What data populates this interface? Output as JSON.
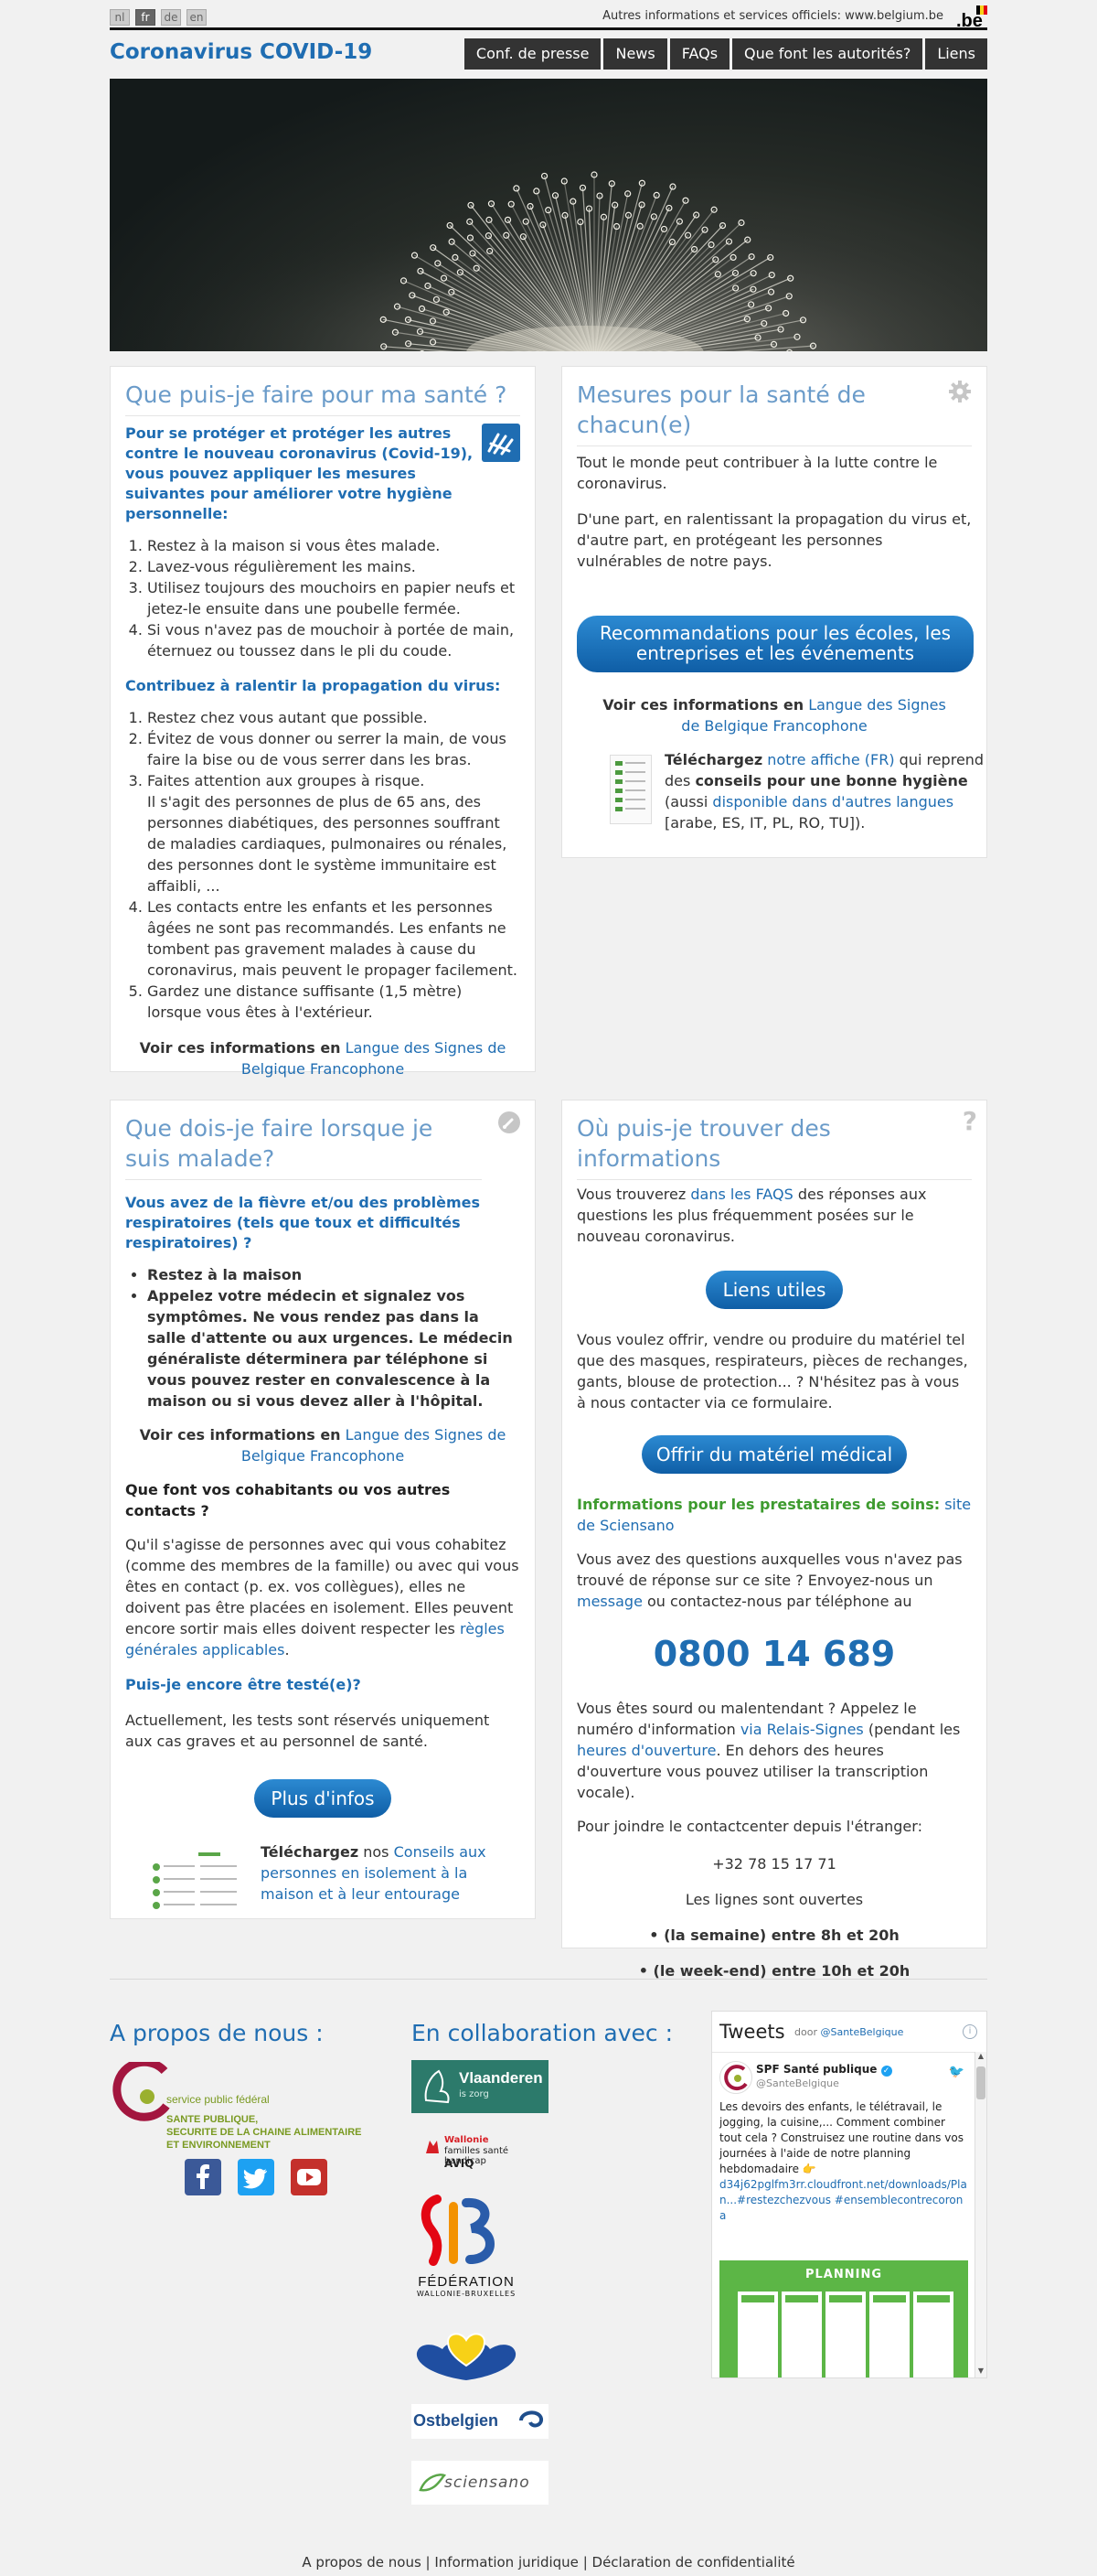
{
  "top": {
    "languages": [
      "nl",
      "fr",
      "de",
      "en"
    ],
    "gov_link": "Autres informations et services officiels: www.belgium.be",
    "be_logo": ".be"
  },
  "header": {
    "title": "Coronavirus COVID-19",
    "nav": [
      "Conf. de presse",
      "News",
      "FAQs",
      "Que font les autorités?",
      "Liens"
    ]
  },
  "panel_health": {
    "title": "Que puis-je faire pour ma santé ?",
    "intro": "Pour se protéger et protéger les autres contre le nouveau coronavirus (Covid-19), vous pouvez appliquer les mesures suivantes pour améliorer votre hygiène personnelle:",
    "hygiene": [
      "Restez à la maison si vous êtes malade.",
      "Lavez-vous régulièrement les mains.",
      "Utilisez toujours des mouchoirs en papier neufs et jetez-le ensuite dans une poubelle fermée.",
      "Si vous n'avez pas de mouchoir à portée de main, éternuez ou toussez dans le pli du coude."
    ],
    "slow_heading": "Contribuez à ralentir la propagation du virus:",
    "slow": [
      "Restez chez vous autant que possible.",
      "Évitez de vous donner ou serrer la main, de vous faire la bise ou de vous serrer dans les bras.",
      "Faites attention aux groupes à risque.",
      "Les contacts entre les enfants et les personnes âgées ne sont pas recommandés. Les enfants ne tombent pas gravement malades à cause du coronavirus, mais peuvent le propager facilement.",
      "Gardez une distance suffisante (1,5 mètre) lorsque vous êtes à l'extérieur."
    ],
    "risk_detail": "Il s'agit des personnes de plus de 65 ans, des personnes diabétiques, des personnes souffrant de maladies cardiaques, pulmonaires ou rénales, des personnes dont le système immunitaire est affaibli, ...",
    "sign_prefix": "Voir ces informations en",
    "sign_link": "Langue des Signes de Belgique Francophone"
  },
  "panel_measures": {
    "title": "Mesures pour la santé de chacun(e)",
    "p1": "Tout le monde peut contribuer à la lutte contre le coronavirus.",
    "p2": "D'une part, en ralentissant la propagation du virus et, d'autre part, en protégeant les personnes vulnérables de notre pays.",
    "btn": "Recommandations pour les écoles, les entreprises et les événements",
    "sign_prefix": "Voir ces informations en",
    "sign_link": "Langue des Signes de Belgique Francophone",
    "dl_bold": "Téléchargez",
    "dl_link": "notre affiche (FR)",
    "dl_mid": "qui reprend des",
    "dl_bold2": "conseils pour une bonne hygiène",
    "dl_aussi": "(aussi",
    "dl_link2": "disponible dans d'autres langues",
    "dl_end": "[arabe, ES, IT, PL, RO, TU])."
  },
  "panel_sick": {
    "title": "Que dois-je faire lorsque je suis malade?",
    "q1": "Vous avez de la fièvre et/ou des problèmes respiratoires (tels que toux et difficultés respiratoires) ?",
    "b1": "Restez à la maison",
    "b2": "Appelez votre médecin et signalez vos symptômes. Ne vous rendez pas dans la salle d'attente ou aux urgences. Le médecin généraliste déterminera par téléphone si vous pouvez rester en convalescence à la maison ou si vous devez aller à l'hôpital.",
    "sign_prefix": "Voir ces informations en",
    "sign_link": "Langue des Signes de Belgique Francophone",
    "q2": "Que font vos cohabitants ou vos autres contacts ?",
    "p2": "Qu'il s'agisse de personnes avec qui vous cohabitez (comme des membres de la famille) ou avec qui vous êtes en contact (p. ex. vos collègues), elles ne doivent pas être placées en isolement. Elles peuvent encore sortir mais elles doivent respecter les",
    "p2_link": "règles générales applicables",
    "q3": "Puis-je encore être testé(e)?",
    "p3": "Actuellement, les tests sont réservés uniquement aux cas graves et au personnel de santé.",
    "btn": "Plus d'infos",
    "dl_bold": "Téléchargez",
    "dl_mid": "nos",
    "dl_link": "Conseils aux personnes en isolement à la maison et à leur entourage"
  },
  "panel_info": {
    "title": "Où puis-je trouver des informations",
    "p1a": "Vous trouverez",
    "p1_link": "dans les FAQS",
    "p1b": "des réponses aux questions les plus fréquemment posées sur le nouveau coronavirus.",
    "btn1": "Liens utiles",
    "p2": "Vous voulez offrir, vendre ou produire du matériel tel que des masques, respirateurs, pièces de rechanges, gants, blouse de protection... ? N'hésitez pas à vous à nous contacter via ce formulaire.",
    "btn2": "Offrir du matériel médical",
    "green": "Informations pour les prestataires de soins:",
    "green_link": "site de Sciensano",
    "p3a": "Vous avez des questions auxquelles vous n'avez pas trouvé de réponse sur ce site ? Envoyez-nous un",
    "p3_link": "message",
    "p3b": "ou contactez-nous par téléphone au",
    "phone": "0800 14 689",
    "p4a": "Vous êtes sourd ou malentendant ? Appelez le numéro d'information",
    "p4_link1": "via Relais-Signes",
    "p4b": "(pendant les",
    "p4_link2": "heures d'ouverture",
    "p4c": ". En dehors des heures d'ouverture vous pouvez utiliser la transcription vocale).",
    "p5": "Pour joindre le contactcenter depuis l'étranger:",
    "intl": "+32 78 15 17 71",
    "hours_title": "Les lignes sont ouvertes",
    "h1": "• (la semaine) entre 8h et 20h",
    "h2": "• (le week-end) entre 10h et 20h"
  },
  "footer": {
    "about_title": "A propos de nous :",
    "spf_line1": "service public fédéral",
    "spf_line2": "SANTE PUBLIQUE,",
    "spf_line3": "SECURITE DE LA CHAINE ALIMENTAIRE",
    "spf_line4": "ET ENVIRONNEMENT",
    "collab_title": "En collaboration avec :",
    "vl_name": "Vlaanderen",
    "vl_sub": "is zorg",
    "aviq_1": "Wallonie",
    "aviq_2": "familles santé handicap",
    "aviq_3": "AVIQ",
    "fwb_1": "FÉDÉRATION",
    "fwb_2": "WALLONIE-BRUXELLES",
    "ost": "Ostbelgien",
    "sciensano": "sciensano",
    "bottom_links": [
      "A propos de nous",
      "Information juridique",
      "Déclaration de confidentialité"
    ]
  },
  "twitter": {
    "title": "Tweets",
    "by": "door",
    "handle": "@SanteBelgique",
    "account": "SPF Santé publique",
    "account_handle": "@SanteBelgique",
    "tweet": "Les devoirs des enfants, le télétravail, le jogging, la cuisine,... Comment combiner tout cela ? Construisez une routine dans vos journées à l'aide de notre planning hebdomadaire 👉",
    "tweet_link": "d34j62pglfm3rr.cloudfront.net/downloads/Plan...#restezchezvous #ensemblecontrecorona",
    "planning": "PLANNING"
  }
}
